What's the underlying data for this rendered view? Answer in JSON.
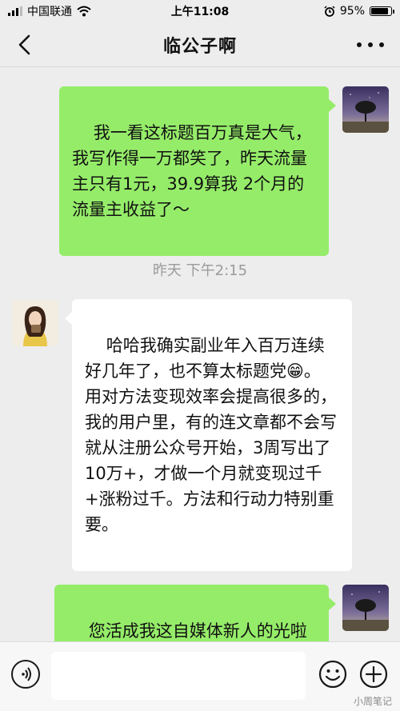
{
  "status_bar": {
    "carrier": "中国联通",
    "time": "上午11:08",
    "battery": "95%",
    "battery_level": 0.95
  },
  "header": {
    "title": "临公子啊"
  },
  "messages": [
    {
      "sender": "me",
      "text": "我一看这标题百万真是大气，我写作得一万都笑了，昨天流量主只有1元，39.9算我 2个月的流量主收益了～"
    },
    {
      "type": "timestamp",
      "text": "昨天 下午2:15"
    },
    {
      "sender": "them",
      "text": "哈哈我确实副业年入百万连续好几年了，也不算太标题党😁。\n用对方法变现效率会提高很多的，我的用户里，有的连文章都不会写就从注册公众号开始，3周写出了10万+，才做一个月就变现过千+涨粉过千。方法和行动力特别重要。"
    },
    {
      "sender": "me",
      "text": "您活成我这自媒体新人的光啦😄🌹"
    }
  ],
  "input": {
    "value": "",
    "placeholder": ""
  },
  "icons": {
    "back": "chevron-left-icon",
    "more": "more-dots-icon",
    "voice": "voice-icon",
    "emoji": "emoji-icon",
    "plus": "plus-icon"
  },
  "colors": {
    "my_bubble": "#95ec69",
    "their_bubble": "#ffffff",
    "background": "#ededed"
  },
  "watermark": "小周笔记"
}
